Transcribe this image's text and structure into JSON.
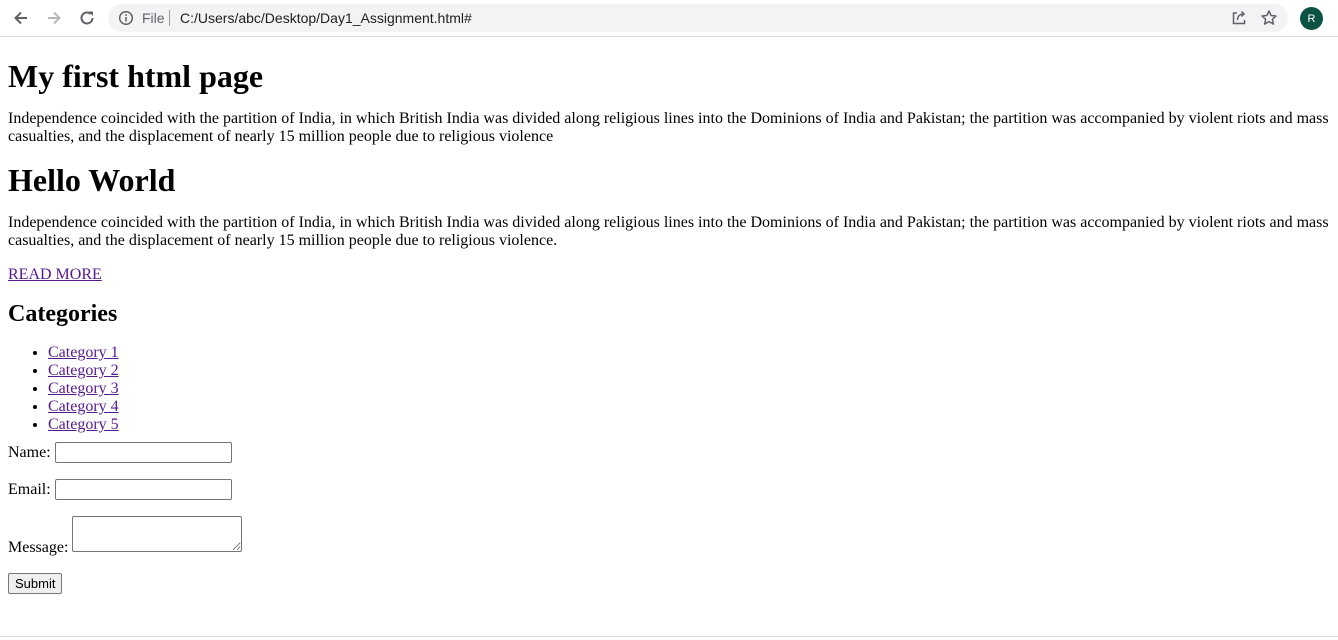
{
  "browser": {
    "file_label": "File",
    "url": "C:/Users/abc/Desktop/Day1_Assignment.html#",
    "avatar_letter": "R",
    "avatar_color": "#0b5345"
  },
  "page": {
    "heading1": "My first html page",
    "paragraph1": "Independence coincided with the partition of India, in which British India was divided along religious lines into the Dominions of India and Pakistan; the partition was accompanied by violent riots and mass casualties, and the displacement of nearly 15 million people due to religious violence",
    "heading2": "Hello World",
    "paragraph2": "Independence coincided with the partition of India, in which British India was divided along religious lines into the Dominions of India and Pakistan; the partition was accompanied by violent riots and mass casualties, and the displacement of nearly 15 million people due to religious violence.",
    "read_more": "READ MORE",
    "categories_title": "Categories",
    "categories": [
      "Category 1",
      "Category 2",
      "Category 3",
      "Category 4",
      "Category 5"
    ],
    "link_color": "#551a8b"
  },
  "form": {
    "name_label": "Name:",
    "name_value": "",
    "email_label": "Email:",
    "email_value": "",
    "message_label": "Message:",
    "message_value": "",
    "submit_label": "Submit"
  }
}
